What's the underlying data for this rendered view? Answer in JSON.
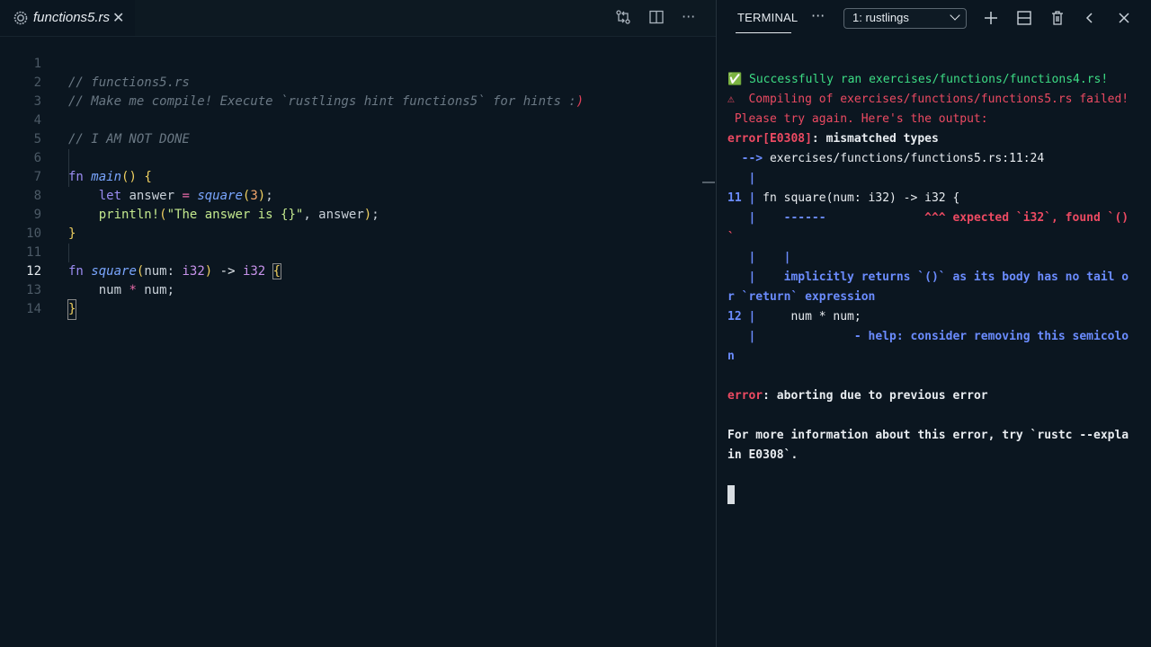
{
  "editor": {
    "tab": {
      "title": "functions5.rs",
      "close": "✕",
      "icon": "rust-icon"
    },
    "actions": {
      "compare": "compare-changes-icon",
      "split": "split-editor-icon",
      "more": "···"
    },
    "lines": [
      {
        "n": "1",
        "t": "// functions5.rs"
      },
      {
        "n": "2",
        "t": "// Make me compile! Execute `rustlings hint functions5` for hints :",
        "tail": ")"
      },
      {
        "n": "3",
        "t": ""
      },
      {
        "n": "4",
        "t": "// I AM NOT DONE"
      },
      {
        "n": "5",
        "t": ""
      },
      {
        "n": "6",
        "t": "fn main() {"
      },
      {
        "n": "7",
        "t": "    let answer = square(3);"
      },
      {
        "n": "8",
        "t": "    println!(\"The answer is {}\", answer);"
      },
      {
        "n": "9",
        "t": "}"
      },
      {
        "n": "10",
        "t": ""
      },
      {
        "n": "11",
        "t": "fn square(num: i32) -> i32 {"
      },
      {
        "n": "12",
        "t": "    num * num;"
      },
      {
        "n": "13",
        "t": "}"
      },
      {
        "n": "14",
        "t": ""
      }
    ],
    "active_line": "12"
  },
  "terminal": {
    "tab_label": "TERMINAL",
    "more": "···",
    "select_value": "1: rustlings",
    "buttons": {
      "new": "+",
      "split": "split-terminal-icon",
      "kill": "trash-icon",
      "back": "chevron-left-icon",
      "close": "✕"
    },
    "output": [
      {
        "segs": [
          {
            "c": "t-green",
            "t": "✅ Successfully ran exercises/functions/functions4.rs!"
          }
        ]
      },
      {
        "segs": [
          {
            "c": "t-red",
            "t": "⚠  Compiling of exercises/functions/functions5.rs failed!"
          }
        ]
      },
      {
        "segs": [
          {
            "c": "t-red",
            "t": " Please try again. Here's the output:"
          }
        ]
      },
      {
        "segs": [
          {
            "c": "t-redb",
            "t": "error[E0308]"
          },
          {
            "c": "t-whiteb",
            "t": ": mismatched types"
          }
        ]
      },
      {
        "segs": [
          {
            "c": "t-blueb",
            "t": "  -->"
          },
          {
            "c": "t-white",
            "t": " exercises/functions/functions5.rs:11:24"
          }
        ]
      },
      {
        "segs": [
          {
            "c": "t-blueb",
            "t": "   |"
          }
        ]
      },
      {
        "segs": [
          {
            "c": "t-blueb",
            "t": "11 |"
          },
          {
            "c": "t-white",
            "t": " fn square(num: i32) -> i32 {"
          }
        ]
      },
      {
        "segs": [
          {
            "c": "t-blueb",
            "t": "   |    ------"
          },
          {
            "c": "t-redb",
            "t": "              ^^^ expected `i32`, found `()"
          }
        ]
      },
      {
        "segs": [
          {
            "c": "t-redb",
            "t": "`"
          }
        ]
      },
      {
        "segs": [
          {
            "c": "t-blueb",
            "t": "   |    |"
          }
        ]
      },
      {
        "segs": [
          {
            "c": "t-blueb",
            "t": "   |    implicitly returns `()` as its body has no tail o"
          }
        ]
      },
      {
        "segs": [
          {
            "c": "t-blueb",
            "t": "r `return` expression"
          }
        ]
      },
      {
        "segs": [
          {
            "c": "t-blueb",
            "t": "12 |"
          },
          {
            "c": "t-white",
            "t": "     num * num;"
          }
        ]
      },
      {
        "segs": [
          {
            "c": "t-blueb",
            "t": "   |              - help: consider removing this semicolo"
          }
        ]
      },
      {
        "segs": [
          {
            "c": "t-blueb",
            "t": "n"
          }
        ]
      },
      {
        "segs": [
          {
            "c": "t-white",
            "t": ""
          }
        ]
      },
      {
        "segs": [
          {
            "c": "t-redb",
            "t": "error"
          },
          {
            "c": "t-whiteb",
            "t": ": aborting due to previous error"
          }
        ]
      },
      {
        "segs": [
          {
            "c": "t-white",
            "t": ""
          }
        ]
      },
      {
        "segs": [
          {
            "c": "t-whiteb",
            "t": "For more information about this error, try `rustc --expla"
          }
        ]
      },
      {
        "segs": [
          {
            "c": "t-whiteb",
            "t": "in E0308`."
          }
        ]
      },
      {
        "segs": [
          {
            "c": "t-white",
            "t": ""
          }
        ]
      },
      {
        "segs": [
          {
            "c": "cursor",
            "t": ""
          }
        ]
      }
    ]
  }
}
